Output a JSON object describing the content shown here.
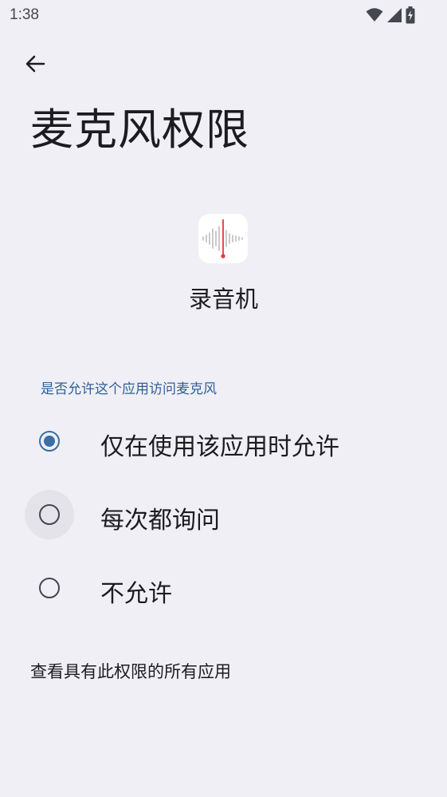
{
  "status_bar": {
    "time": "1:38",
    "icons": [
      "wifi-icon",
      "cell-signal-icon",
      "battery-charging-icon"
    ]
  },
  "header": {
    "back_icon": "arrow-back-icon",
    "title": "麦克风权限"
  },
  "app": {
    "icon": "voice-recorder-icon",
    "name": "录音机"
  },
  "permission": {
    "section_header": "是否允许这个应用访问麦克风",
    "options": [
      {
        "label": "仅在使用该应用时允许",
        "selected": true
      },
      {
        "label": "每次都询问",
        "selected": false
      },
      {
        "label": "不允许",
        "selected": false
      }
    ]
  },
  "footer": {
    "link_label": "查看具有此权限的所有应用"
  },
  "colors": {
    "background": "#f0eff5",
    "accent": "#3a6ea5",
    "section_header": "#2f5f98",
    "recorder_needle": "#e53935"
  }
}
